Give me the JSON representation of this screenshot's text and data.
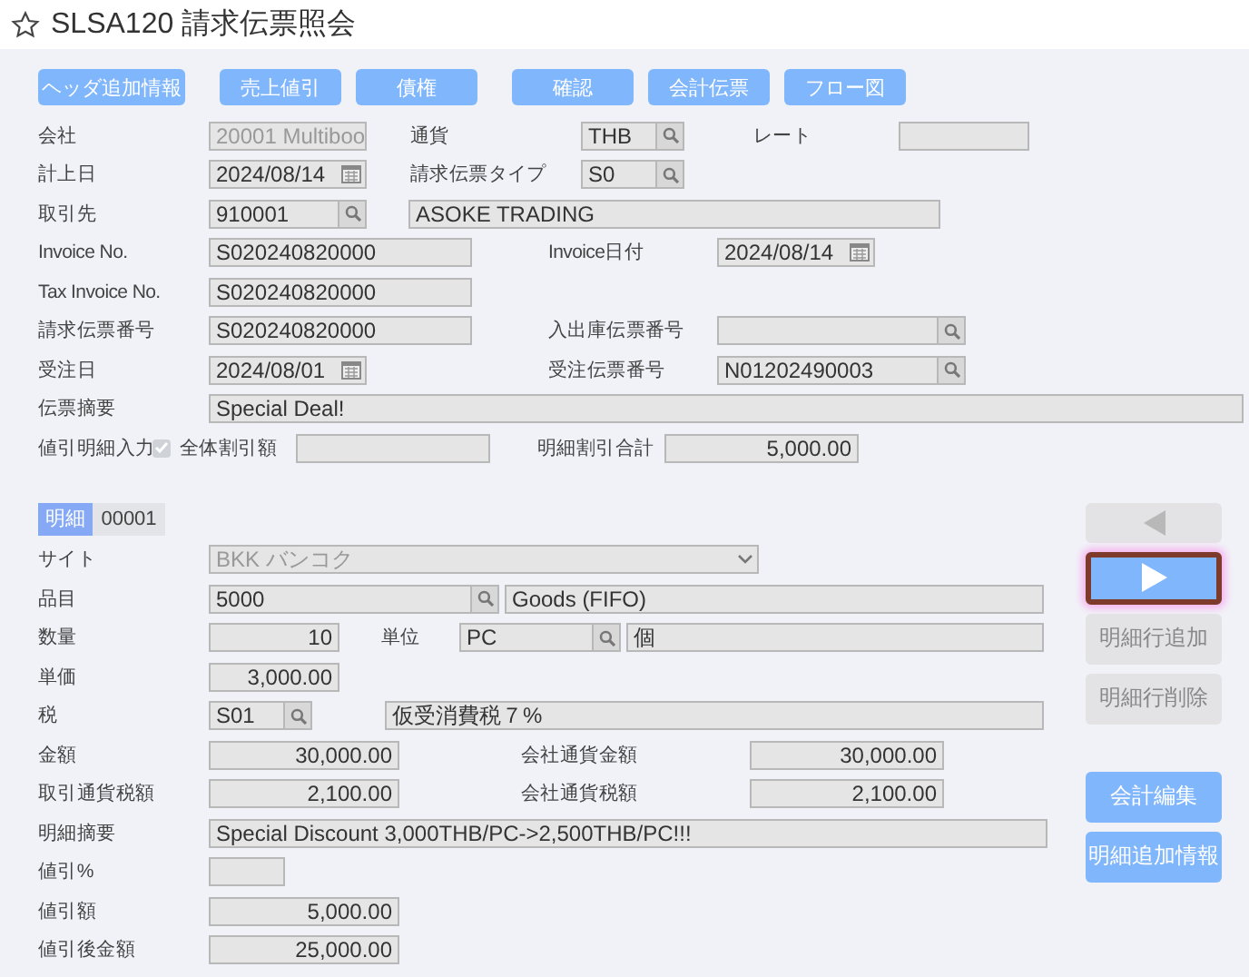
{
  "window": {
    "title": "SLSA120 請求伝票照会",
    "favorite": false
  },
  "toolbar": [
    "ヘッダ追加情報",
    "売上値引",
    "債権",
    "確認",
    "会計伝票",
    "フロー図"
  ],
  "header_rows": [
    [
      {
        "kind": "label",
        "text": "会社"
      },
      {
        "kind": "select",
        "value": "20001 Multiboo",
        "disabled": true
      },
      {
        "kind": "label",
        "text": "通貨"
      },
      {
        "kind": "lookup",
        "value": "THB"
      },
      {
        "kind": "label",
        "text": "レート"
      },
      {
        "kind": "text"
      }
    ],
    [
      {
        "kind": "label",
        "text": "計上日"
      },
      {
        "kind": "date",
        "value": "2024/08/14"
      },
      {
        "kind": "label",
        "text": "請求伝票タイプ"
      },
      {
        "kind": "lookup",
        "value": "S0"
      }
    ],
    [
      {
        "kind": "label",
        "text": "取引先"
      },
      {
        "kind": "lookup",
        "value": "910001"
      },
      {
        "kind": "text",
        "value": "ASOKE TRADING"
      }
    ],
    [
      {
        "kind": "label",
        "text": "Invoice No."
      },
      {
        "kind": "text",
        "value": "S020240820000"
      },
      {
        "kind": "label",
        "text": "Invoice日付"
      },
      {
        "kind": "date",
        "value": "2024/08/14"
      }
    ],
    [
      {
        "kind": "label",
        "text": "Tax Invoice No."
      },
      {
        "kind": "text",
        "value": "S020240820000"
      }
    ],
    [
      {
        "kind": "label",
        "text": "請求伝票番号"
      },
      {
        "kind": "text",
        "value": "S020240820000"
      },
      {
        "kind": "label",
        "text": "入出庫伝票番号"
      },
      {
        "kind": "lookup"
      }
    ],
    [
      {
        "kind": "label",
        "text": "受注日"
      },
      {
        "kind": "date",
        "value": "2024/08/01"
      },
      {
        "kind": "label",
        "text": "受注伝票番号"
      },
      {
        "kind": "lookup",
        "value": "N01202490003"
      }
    ],
    [
      {
        "kind": "label",
        "text": "伝票摘要"
      },
      {
        "kind": "text",
        "value": "Special Deal!"
      }
    ],
    [
      {
        "kind": "label",
        "text": "値引明細入力"
      },
      {
        "kind": "checkbox",
        "checked": true,
        "disabled": true
      },
      {
        "kind": "label",
        "text": "全体割引額"
      },
      {
        "kind": "amount"
      },
      {
        "kind": "label",
        "text": "明細割引合計"
      },
      {
        "kind": "amount",
        "value": "5,000.00"
      }
    ]
  ],
  "detail": {
    "tabs": [
      {
        "label": "明細",
        "selected": true
      }
    ],
    "line_no": "00001",
    "rows": [
      [
        {
          "kind": "label",
          "text": "サイト"
        },
        {
          "kind": "select",
          "value": "BKK バンコク",
          "disabled": true
        }
      ],
      [
        {
          "kind": "label",
          "text": "品目"
        },
        {
          "kind": "lookup",
          "value": "5000"
        },
        {
          "kind": "text",
          "value": "Goods (FIFO)"
        }
      ],
      [
        {
          "kind": "label",
          "text": "数量"
        },
        {
          "kind": "amount",
          "value": "10"
        },
        {
          "kind": "label",
          "text": "単位"
        },
        {
          "kind": "lookup",
          "value": "PC"
        },
        {
          "kind": "text",
          "value": "個"
        }
      ],
      [
        {
          "kind": "label",
          "text": "単価"
        },
        {
          "kind": "amount",
          "value": "3,000.00"
        }
      ],
      [
        {
          "kind": "label",
          "text": "税"
        },
        {
          "kind": "lookup",
          "value": "S01"
        },
        {
          "kind": "text",
          "value": "仮受消費税７%"
        }
      ],
      [
        {
          "kind": "label",
          "text": "金額"
        },
        {
          "kind": "amount",
          "value": "30,000.00"
        },
        {
          "kind": "label",
          "text": "会社通貨金額"
        },
        {
          "kind": "amount",
          "value": "30,000.00"
        }
      ],
      [
        {
          "kind": "label",
          "text": "取引通貨税額"
        },
        {
          "kind": "amount",
          "value": "2,100.00"
        },
        {
          "kind": "label",
          "text": "会社通貨税額"
        },
        {
          "kind": "amount",
          "value": "2,100.00"
        }
      ],
      [
        {
          "kind": "label",
          "text": "明細摘要"
        },
        {
          "kind": "text",
          "value": "Special Discount 3,000THB/PC->2,500THB/PC!!!"
        }
      ],
      [
        {
          "kind": "label",
          "text": "値引%"
        },
        {
          "kind": "amount"
        }
      ],
      [
        {
          "kind": "label",
          "text": "値引額"
        },
        {
          "kind": "amount",
          "value": "5,000.00"
        }
      ],
      [
        {
          "kind": "label",
          "text": "値引後金額"
        },
        {
          "kind": "amount",
          "value": "25,000.00"
        }
      ]
    ],
    "nav_buttons": [
      {
        "kind": "prev",
        "disabled": true,
        "focused": false
      },
      {
        "kind": "next",
        "disabled": false,
        "focused": true
      },
      {
        "kind": "text",
        "label": "明細行追加",
        "disabled": true,
        "focused": false
      },
      {
        "kind": "text",
        "label": "明細行削除",
        "disabled": true,
        "focused": false
      }
    ],
    "action_buttons": [
      {
        "label": "会計編集",
        "disabled": false
      },
      {
        "label": "明細追加情報",
        "disabled": false
      }
    ]
  }
}
